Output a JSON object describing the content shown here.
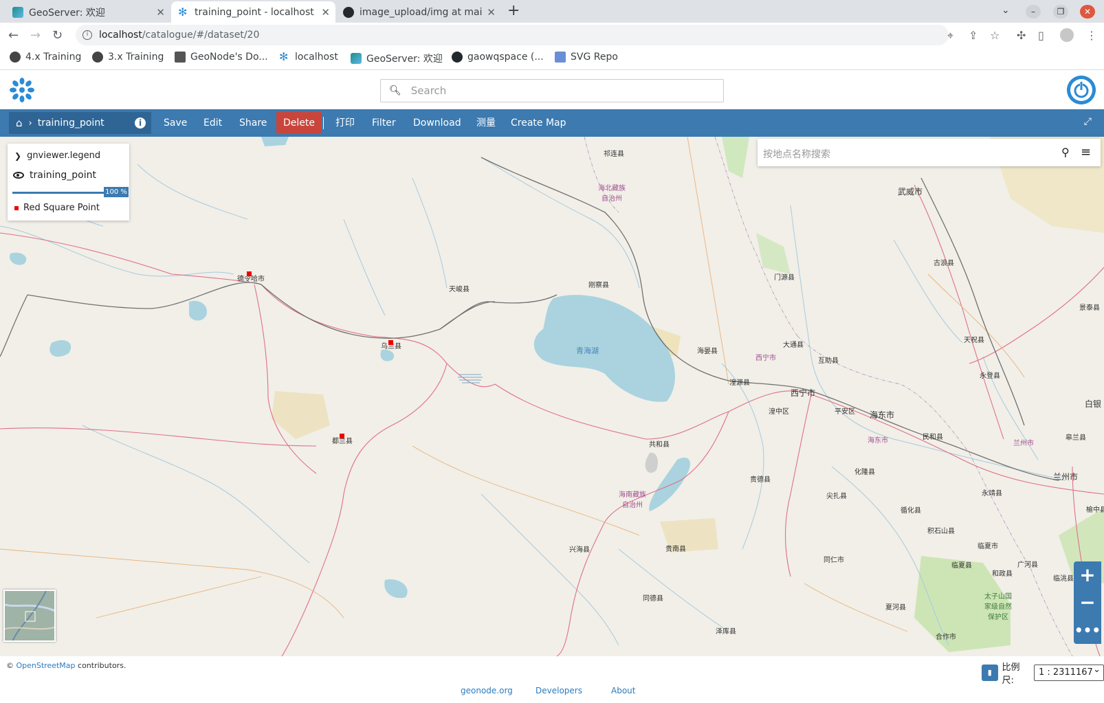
{
  "browser": {
    "tabs": [
      {
        "title": "GeoServer: 欢迎",
        "active": false
      },
      {
        "title": "training_point - localhost",
        "active": true
      },
      {
        "title": "image_upload/img at mai",
        "active": false
      }
    ],
    "url_host": "localhost",
    "url_path": "/catalogue/#/dataset/20",
    "bookmarks": [
      "4.x Training",
      "3.x Training",
      "GeoNode's Do...",
      "localhost",
      "GeoServer: 欢迎",
      "gaowqspace (...",
      "SVG Repo"
    ]
  },
  "header": {
    "search_placeholder": "Search"
  },
  "toolbar": {
    "breadcrumb_title": "training_point",
    "save": "Save",
    "edit": "Edit",
    "share": "Share",
    "delete": "Delete",
    "print": "打印",
    "filter": "Filter",
    "download": "Download",
    "measure": "测量",
    "create_map": "Create Map"
  },
  "legend": {
    "header": "gnviewer.legend",
    "layer_name": "training_point",
    "opacity": "100 %",
    "item_label": "Red Square Point"
  },
  "place_search": {
    "placeholder": "按地点名称搜索"
  },
  "map_labels": [
    {
      "id": "qilian",
      "text": "祁连县"
    },
    {
      "id": "haibei",
      "text": "海北藏族\n自治州"
    },
    {
      "id": "wuwei",
      "text": "武威市"
    },
    {
      "id": "gulang",
      "text": "古浪县"
    },
    {
      "id": "menyuan",
      "text": "门源县"
    },
    {
      "id": "delingha",
      "text": "德令哈市"
    },
    {
      "id": "tianjun",
      "text": "天峻县"
    },
    {
      "id": "gangcha",
      "text": "刚察县"
    },
    {
      "id": "jingtai",
      "text": "景泰县"
    },
    {
      "id": "tianzhu",
      "text": "天祝县"
    },
    {
      "id": "datong",
      "text": "大通县"
    },
    {
      "id": "haiyan",
      "text": "海晏县"
    },
    {
      "id": "wulan",
      "text": "乌兰县"
    },
    {
      "id": "qinghaihu",
      "text": "青海湖"
    },
    {
      "id": "xiningregion",
      "text": "西宁市"
    },
    {
      "id": "huzhu",
      "text": "互助县"
    },
    {
      "id": "yongdeng",
      "text": "永登县"
    },
    {
      "id": "huangyuan",
      "text": "湟源县"
    },
    {
      "id": "xining",
      "text": "西宁市"
    },
    {
      "id": "baiyin",
      "text": "白银"
    },
    {
      "id": "huangzhong",
      "text": "湟中区"
    },
    {
      "id": "pingan",
      "text": "平安区"
    },
    {
      "id": "haidong",
      "text": "海东市"
    },
    {
      "id": "haidongregion",
      "text": "海东市"
    },
    {
      "id": "lanzhouregion",
      "text": "兰州市"
    },
    {
      "id": "gaolan",
      "text": "皋兰县"
    },
    {
      "id": "minhe",
      "text": "民和县"
    },
    {
      "id": "dulan",
      "text": "都兰县"
    },
    {
      "id": "gonghe",
      "text": "共和县"
    },
    {
      "id": "hualong",
      "text": "化隆县"
    },
    {
      "id": "lanzhou",
      "text": "兰州市"
    },
    {
      "id": "guide",
      "text": "贵德县"
    },
    {
      "id": "hainan",
      "text": "海南藏族\n自治州"
    },
    {
      "id": "jianzha",
      "text": "尖扎县"
    },
    {
      "id": "yongjing",
      "text": "永靖县"
    },
    {
      "id": "xunhua",
      "text": "循化县"
    },
    {
      "id": "yuzhong",
      "text": "榆中县"
    },
    {
      "id": "jishishan",
      "text": "积石山县"
    },
    {
      "id": "xinghai",
      "text": "兴海县"
    },
    {
      "id": "guinan",
      "text": "贵南县"
    },
    {
      "id": "linxiaxian",
      "text": "临夏市"
    },
    {
      "id": "tongren",
      "text": "同仁市"
    },
    {
      "id": "linxia",
      "text": "临夏县"
    },
    {
      "id": "guanghe",
      "text": "广河县"
    },
    {
      "id": "hezheng",
      "text": "和政县"
    },
    {
      "id": "lintao",
      "text": "临洮县"
    },
    {
      "id": "taizishan",
      "text": "太子山国\n家级自然\n保护区"
    },
    {
      "id": "tongde",
      "text": "同德县"
    },
    {
      "id": "xiahe",
      "text": "夏河县"
    },
    {
      "id": "zeku",
      "text": "泽库县"
    },
    {
      "id": "hezuo",
      "text": "合作市"
    }
  ],
  "attribution": {
    "prefix": "©",
    "link": "OpenStreetMap",
    "suffix": "contributors."
  },
  "scale": {
    "label": "比例尺:",
    "value": "1 : 2311167"
  },
  "footer": {
    "links": [
      "geonode.org",
      "Developers",
      "About"
    ]
  },
  "colors": {
    "toolbar": "#3c7ab0",
    "breadcrumb": "#2f6595",
    "delete": "#c9453b",
    "point": "#ee0000",
    "water": "#aad3df",
    "land": "#f1efe8"
  }
}
